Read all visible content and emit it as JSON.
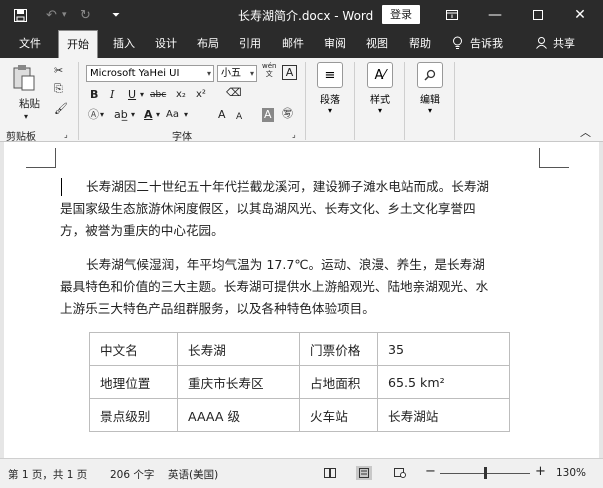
{
  "titlebar": {
    "save_icon": "save-icon",
    "undo_icon": "undo-icon",
    "redo_icon": "redo-icon",
    "customize_icon": "customize-qat-icon",
    "doc_title": "长寿湖简介.docx  -  Word",
    "login_label": "登录",
    "ribbon_display_icon": "ribbon-display-options-icon",
    "minimize_icon": "minimize-icon",
    "restore_icon": "restore-icon",
    "close_icon": "close-icon"
  },
  "tabs": [
    "文件",
    "开始",
    "插入",
    "设计",
    "布局",
    "引用",
    "邮件",
    "审阅",
    "视图",
    "帮助"
  ],
  "active_tab": "开始",
  "tellme_label": "告诉我",
  "share_label": "共享",
  "ribbon": {
    "clipboard": {
      "paste_label": "粘贴",
      "group_label": "剪贴板"
    },
    "font": {
      "font_name": "Microsoft YaHei UI",
      "font_size": "小五",
      "wen_label": "wén\n文",
      "A_box": "A",
      "bold": "B",
      "italic": "I",
      "underline": "U",
      "strike": "abc",
      "subscript": "x₂",
      "superscript": "x²",
      "aa_label": "Aa",
      "grow": "A",
      "shrink": "A",
      "group_label": "字体"
    },
    "paragraph": {
      "label": "段落"
    },
    "styles": {
      "label": "样式"
    },
    "editing": {
      "label": "编辑"
    }
  },
  "document": {
    "para1_line1": "长寿湖因二十世纪五十年代拦截龙溪河，建设狮子滩水电站而成。长寿湖",
    "para1_line2": "是国家级生态旅游休闲度假区，以其岛湖风光、长寿文化、乡土文化享誉四",
    "para1_line3": "方，被誉为重庆的中心花园。",
    "para2_line1": "长寿湖气候湿润，年平均气温为 17.7℃。运动、浪漫、养生，是长寿湖",
    "para2_line2": "最具特色和价值的三大主题。长寿湖可提供水上游船观光、陆地亲湖观光、水",
    "para2_line3": "上游乐三大特色产品组群服务，以及各种特色体验项目。",
    "table": [
      [
        "中文名",
        "长寿湖",
        "门票价格",
        "35"
      ],
      [
        "地理位置",
        "重庆市长寿区",
        "占地面积",
        "65.5 km²"
      ],
      [
        "景点级别",
        "AAAA 级",
        "火车站",
        "长寿湖站"
      ]
    ]
  },
  "statusbar": {
    "page": "第 1 页，共 1 页",
    "words": "206 个字",
    "language": "英语(美国)",
    "zoom_minus": "−",
    "zoom_plus": "+",
    "zoom": "130%"
  }
}
